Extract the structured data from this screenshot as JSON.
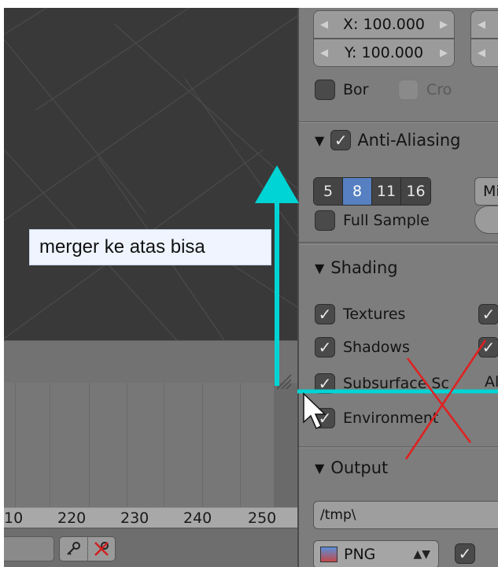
{
  "annotation": {
    "text": "merger ke atas bisa",
    "arrow_color": "#00d4d4",
    "cross_color": "#e02020"
  },
  "timeline": {
    "ticks": [
      "10",
      "220",
      "230",
      "240",
      "250"
    ]
  },
  "properties": {
    "dimensions": {
      "x_field": "X: 100.000",
      "y_field": "Y: 100.000",
      "border_label": "Bor",
      "crop_label": "Cro"
    },
    "anti_aliasing": {
      "title": "Anti-Aliasing",
      "samples": [
        "5",
        "8",
        "11",
        "16"
      ],
      "selected": "8",
      "filter_label": "Mi",
      "full_sample_label": "Full Sample"
    },
    "shading": {
      "title": "Shading",
      "items": [
        "Textures",
        "Shadows",
        "Subsurface Sc",
        "Environment"
      ],
      "right_label": "Al"
    },
    "output": {
      "title": "Output",
      "path": "/tmp\\",
      "format": "PNG"
    }
  },
  "colors": {
    "viewport_bg": "#393939",
    "panel_bg": "#7d7d7d",
    "accent": "#5680c2"
  }
}
